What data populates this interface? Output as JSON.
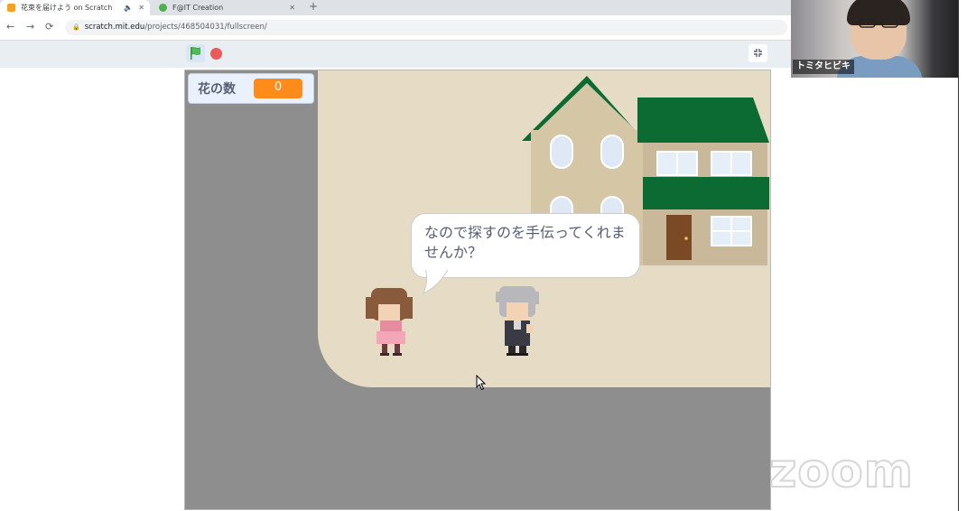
{
  "browser": {
    "tabs": [
      {
        "title": "花束を届けよう on Scratch",
        "active": true,
        "has_audio_icon": true
      },
      {
        "title": "F@IT Creation",
        "active": false
      }
    ],
    "close_glyph": "✕",
    "audio_glyph": "🔈",
    "new_tab_glyph": "+",
    "nav": {
      "back": "←",
      "forward": "→",
      "reload": "⟳"
    },
    "url": {
      "host": "scratch.mit.edu",
      "path": "/projects/468504031/fullscreen/"
    }
  },
  "scratch": {
    "variable_monitor": {
      "label": "花の数",
      "value": "0"
    },
    "speech_bubble": "なので探すのを手伝ってくれませんか？",
    "colors": {
      "ground": "#e6dcc6",
      "road": "#8e8e8e",
      "roof": "#0b6b33",
      "monitor_value": "#ff8c1a",
      "flag": "#4cbf56",
      "stop": "#ec5959"
    }
  },
  "webcam": {
    "participant_name": "トミタヒビキ"
  },
  "watermark": "zoom"
}
